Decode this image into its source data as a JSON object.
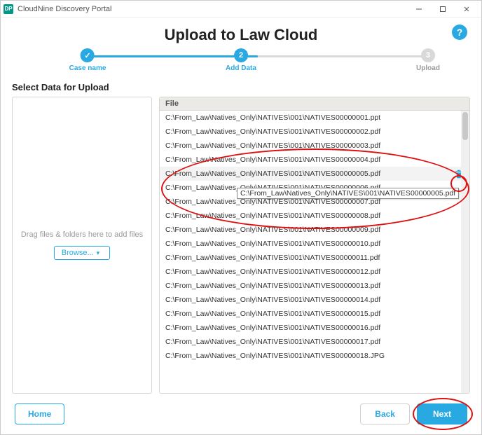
{
  "window": {
    "title": "CloudNine Discovery Portal",
    "logo_text": "DP"
  },
  "header": {
    "page_title": "Upload to Law Cloud",
    "help_symbol": "?"
  },
  "stepper": {
    "step1": {
      "label": "Case name",
      "symbol": "✓"
    },
    "step2": {
      "label": "Add Data",
      "symbol": "2"
    },
    "step3": {
      "label": "Upload",
      "symbol": "3"
    }
  },
  "section_title": "Select Data for Upload",
  "dropzone": {
    "hint": "Drag files & folders here to add files",
    "browse_label": "Browse..."
  },
  "file_table": {
    "header": "File",
    "hovered_index": 4,
    "tooltip_text": "C:\\From_Law\\Natives_Only\\NATIVES\\001\\NATIVES00000005.pdf",
    "rows": [
      "C:\\From_Law\\Natives_Only\\NATIVES\\001\\NATIVES00000001.ppt",
      "C:\\From_Law\\Natives_Only\\NATIVES\\001\\NATIVES00000002.pdf",
      "C:\\From_Law\\Natives_Only\\NATIVES\\001\\NATIVES00000003.pdf",
      "C:\\From_Law\\Natives_Only\\NATIVES\\001\\NATIVES00000004.pdf",
      "C:\\From_Law\\Natives_Only\\NATIVES\\001\\NATIVES00000005.pdf",
      "C:\\From_Law\\Natives_Only\\NATIVES\\001\\NATIVES00000006.pdf",
      "C:\\From_Law\\Natives_Only\\NATIVES\\001\\NATIVES00000007.pdf",
      "C:\\From_Law\\Natives_Only\\NATIVES\\001\\NATIVES00000008.pdf",
      "C:\\From_Law\\Natives_Only\\NATIVES\\001\\NATIVES00000009.pdf",
      "C:\\From_Law\\Natives_Only\\NATIVES\\001\\NATIVES00000010.pdf",
      "C:\\From_Law\\Natives_Only\\NATIVES\\001\\NATIVES00000011.pdf",
      "C:\\From_Law\\Natives_Only\\NATIVES\\001\\NATIVES00000012.pdf",
      "C:\\From_Law\\Natives_Only\\NATIVES\\001\\NATIVES00000013.pdf",
      "C:\\From_Law\\Natives_Only\\NATIVES\\001\\NATIVES00000014.pdf",
      "C:\\From_Law\\Natives_Only\\NATIVES\\001\\NATIVES00000015.pdf",
      "C:\\From_Law\\Natives_Only\\NATIVES\\001\\NATIVES00000016.pdf",
      "C:\\From_Law\\Natives_Only\\NATIVES\\001\\NATIVES00000017.pdf",
      "C:\\From_Law\\Natives_Only\\NATIVES\\001\\NATIVES00000018.JPG"
    ]
  },
  "footer": {
    "home": "Home",
    "back": "Back",
    "next": "Next"
  },
  "colors": {
    "accent": "#29a9e1",
    "annotation": "#d11"
  }
}
